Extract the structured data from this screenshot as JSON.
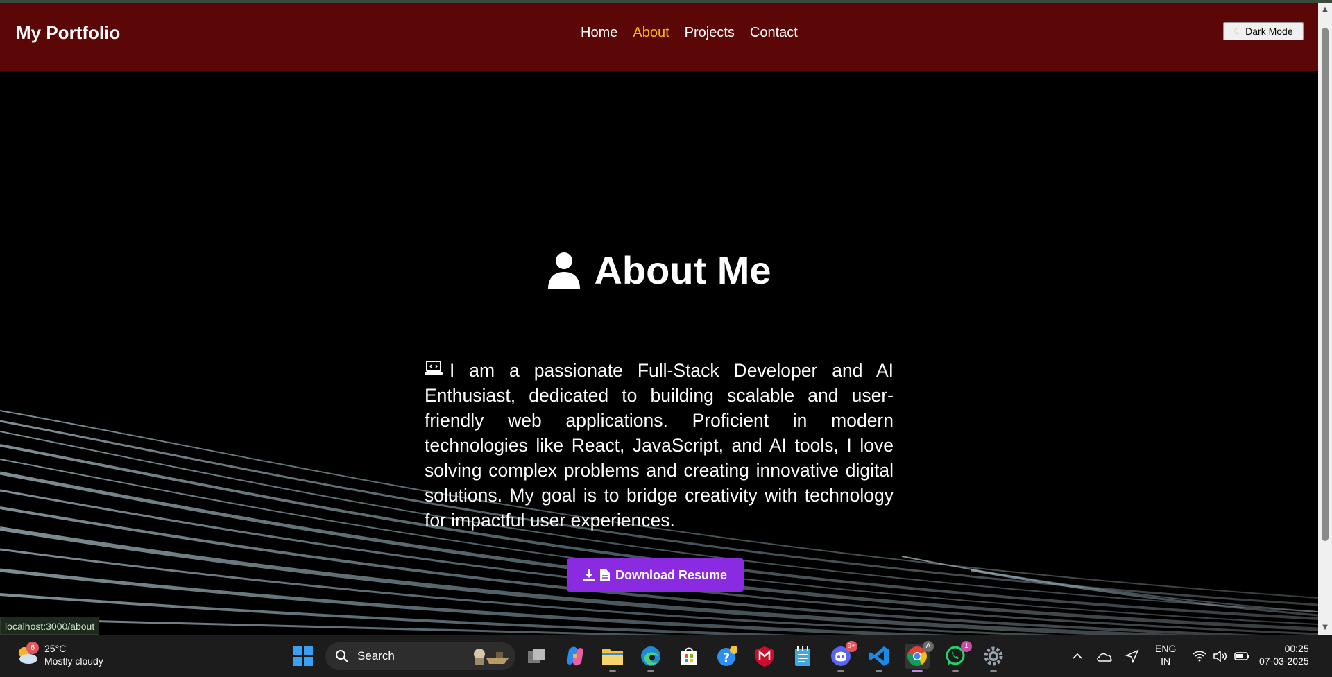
{
  "navbar": {
    "brand": "My Portfolio",
    "links": [
      {
        "label": "Home",
        "active": false
      },
      {
        "label": "About",
        "active": true
      },
      {
        "label": "Projects",
        "active": false
      },
      {
        "label": "Contact",
        "active": false
      }
    ],
    "dark_mode_label": "Dark Mode"
  },
  "about": {
    "title": "About Me",
    "text": "I am a passionate Full-Stack Developer and AI Enthusiast, dedicated to building scalable and user-friendly web applications. Proficient in modern technologies like React, JavaScript, and AI tools, I love solving complex problems and creating innovative digital solutions. My goal is to bridge creativity with technology for impactful user experiences.",
    "button_label": "Download Resume"
  },
  "status_url": "localhost:3000/about",
  "taskbar": {
    "weather_badge": "6",
    "temperature": "25°C",
    "condition": "Mostly cloudy",
    "search_label": "Search",
    "discord_badge": "9+",
    "whatsapp_badge": "1",
    "chrome_badge": "A",
    "lang_line1": "ENG",
    "lang_line2": "IN",
    "time": "00:25",
    "date": "07-03-2025"
  },
  "colors": {
    "navbar_bg": "#5c0707",
    "active_link": "#f6b900",
    "button_bg": "#8a2be2"
  }
}
